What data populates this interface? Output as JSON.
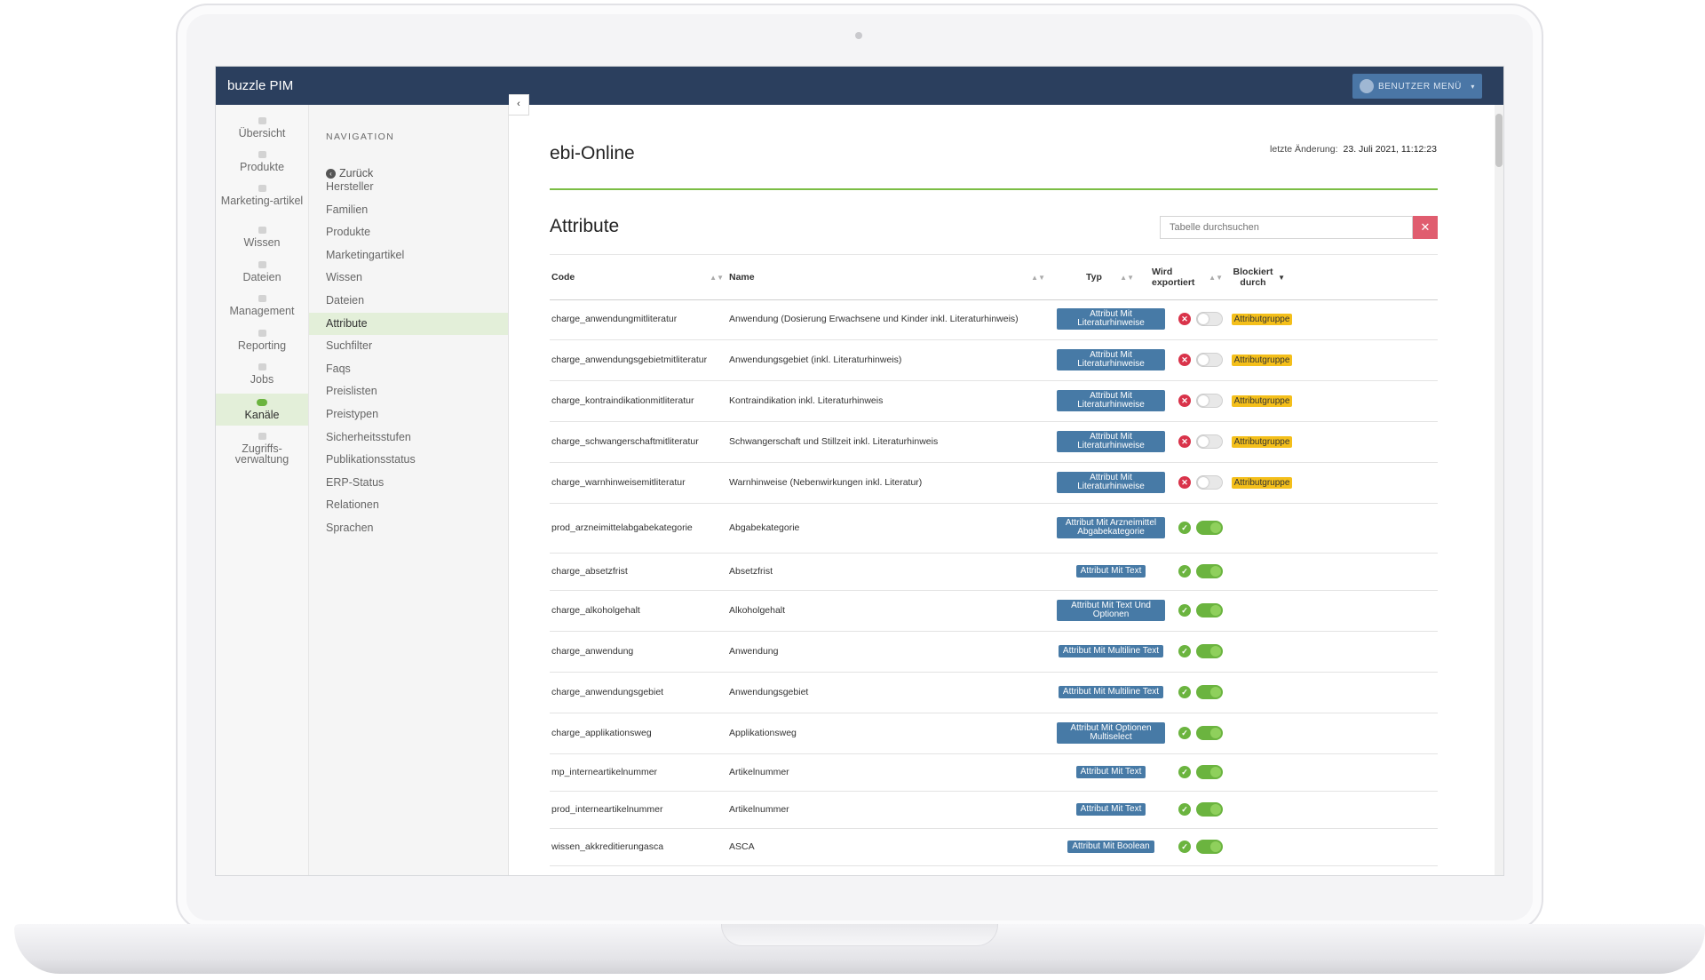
{
  "app": {
    "title": "buzzle PIM"
  },
  "user_menu": {
    "label": "BENUTZER MENÜ"
  },
  "sidebar": {
    "items": [
      {
        "label": "Übersicht",
        "icon": "dashboard-icon"
      },
      {
        "label": "Produkte",
        "icon": "box-icon"
      },
      {
        "label": "Marketing-artikel",
        "icon": "marketing-icon"
      },
      {
        "label": "Wissen",
        "icon": "knowledge-icon"
      },
      {
        "label": "Dateien",
        "icon": "files-icon"
      },
      {
        "label": "Management",
        "icon": "management-icon"
      },
      {
        "label": "Reporting",
        "icon": "reporting-icon"
      },
      {
        "label": "Jobs",
        "icon": "jobs-icon"
      },
      {
        "label": "Kanäle",
        "icon": "toggle-icon",
        "active": true
      },
      {
        "label": "Zugriffs-verwaltung",
        "icon": "users-icon"
      }
    ]
  },
  "navigation": {
    "heading": "NAVIGATION",
    "back": "Zurück",
    "items": [
      "Hersteller",
      "Familien",
      "Produkte",
      "Marketingartikel",
      "Wissen",
      "Dateien",
      "Attribute",
      "Suchfilter",
      "Faqs",
      "Preislisten",
      "Preistypen",
      "Sicherheitsstufen",
      "Publikationsstatus",
      "ERP-Status",
      "Relationen",
      "Sprachen"
    ],
    "active": "Attribute"
  },
  "page": {
    "title": "ebi-Online",
    "last_change_label": "letzte Änderung:",
    "last_change_value": "23. Juli 2021, 11:12:23",
    "section_title": "Attribute",
    "search_placeholder": "Tabelle durchsuchen"
  },
  "table": {
    "headers": {
      "code": "Code",
      "name": "Name",
      "typ": "Typ",
      "exported": "Wird exportiert",
      "blocked": "Blockiert durch"
    },
    "rows": [
      {
        "code": "charge_anwendungmitliteratur",
        "name": "Anwendung (Dosierung Erwachsene und Kinder inkl. Literaturhinweis)",
        "typ": "Attribut Mit Literaturhinweise",
        "exported": false,
        "blocked": "Attributgruppe"
      },
      {
        "code": "charge_anwendungsgebietmitliteratur",
        "name": "Anwendungsgebiet (inkl. Literaturhinweis)",
        "typ": "Attribut Mit Literaturhinweise",
        "exported": false,
        "blocked": "Attributgruppe"
      },
      {
        "code": "charge_kontraindikationmitliteratur",
        "name": "Kontraindikation inkl. Literaturhinweis",
        "typ": "Attribut Mit Literaturhinweise",
        "exported": false,
        "blocked": "Attributgruppe"
      },
      {
        "code": "charge_schwangerschaftmitliteratur",
        "name": "Schwangerschaft und Stillzeit inkl. Literaturhinweis",
        "typ": "Attribut Mit Literaturhinweise",
        "exported": false,
        "blocked": "Attributgruppe"
      },
      {
        "code": "charge_warnhinweisemitliteratur",
        "name": "Warnhinweise (Nebenwirkungen inkl. Literatur)",
        "typ": "Attribut Mit Literaturhinweise",
        "exported": false,
        "blocked": "Attributgruppe"
      },
      {
        "code": "prod_arzneimittelabgabekategorie",
        "name": "Abgabekategorie",
        "typ": "Attribut Mit Arzneimittel Abgabekategorie",
        "exported": true,
        "blocked": ""
      },
      {
        "code": "charge_absetzfrist",
        "name": "Absetzfrist",
        "typ": "Attribut Mit Text",
        "exported": true,
        "blocked": ""
      },
      {
        "code": "charge_alkoholgehalt",
        "name": "Alkoholgehalt",
        "typ": "Attribut Mit Text Und Optionen",
        "exported": true,
        "blocked": ""
      },
      {
        "code": "charge_anwendung",
        "name": "Anwendung",
        "typ": "Attribut Mit Multiline Text",
        "exported": true,
        "blocked": ""
      },
      {
        "code": "charge_anwendungsgebiet",
        "name": "Anwendungsgebiet",
        "typ": "Attribut Mit Multiline Text",
        "exported": true,
        "blocked": ""
      },
      {
        "code": "charge_applikationsweg",
        "name": "Applikationsweg",
        "typ": "Attribut Mit Optionen Multiselect",
        "exported": true,
        "blocked": ""
      },
      {
        "code": "mp_interneartikelnummer",
        "name": "Artikelnummer",
        "typ": "Attribut Mit Text",
        "exported": true,
        "blocked": ""
      },
      {
        "code": "prod_interneartikelnummer",
        "name": "Artikelnummer",
        "typ": "Attribut Mit Text",
        "exported": true,
        "blocked": ""
      },
      {
        "code": "wissen_akkreditierungasca",
        "name": "ASCA",
        "typ": "Attribut Mit Boolean",
        "exported": true,
        "blocked": ""
      }
    ]
  }
}
